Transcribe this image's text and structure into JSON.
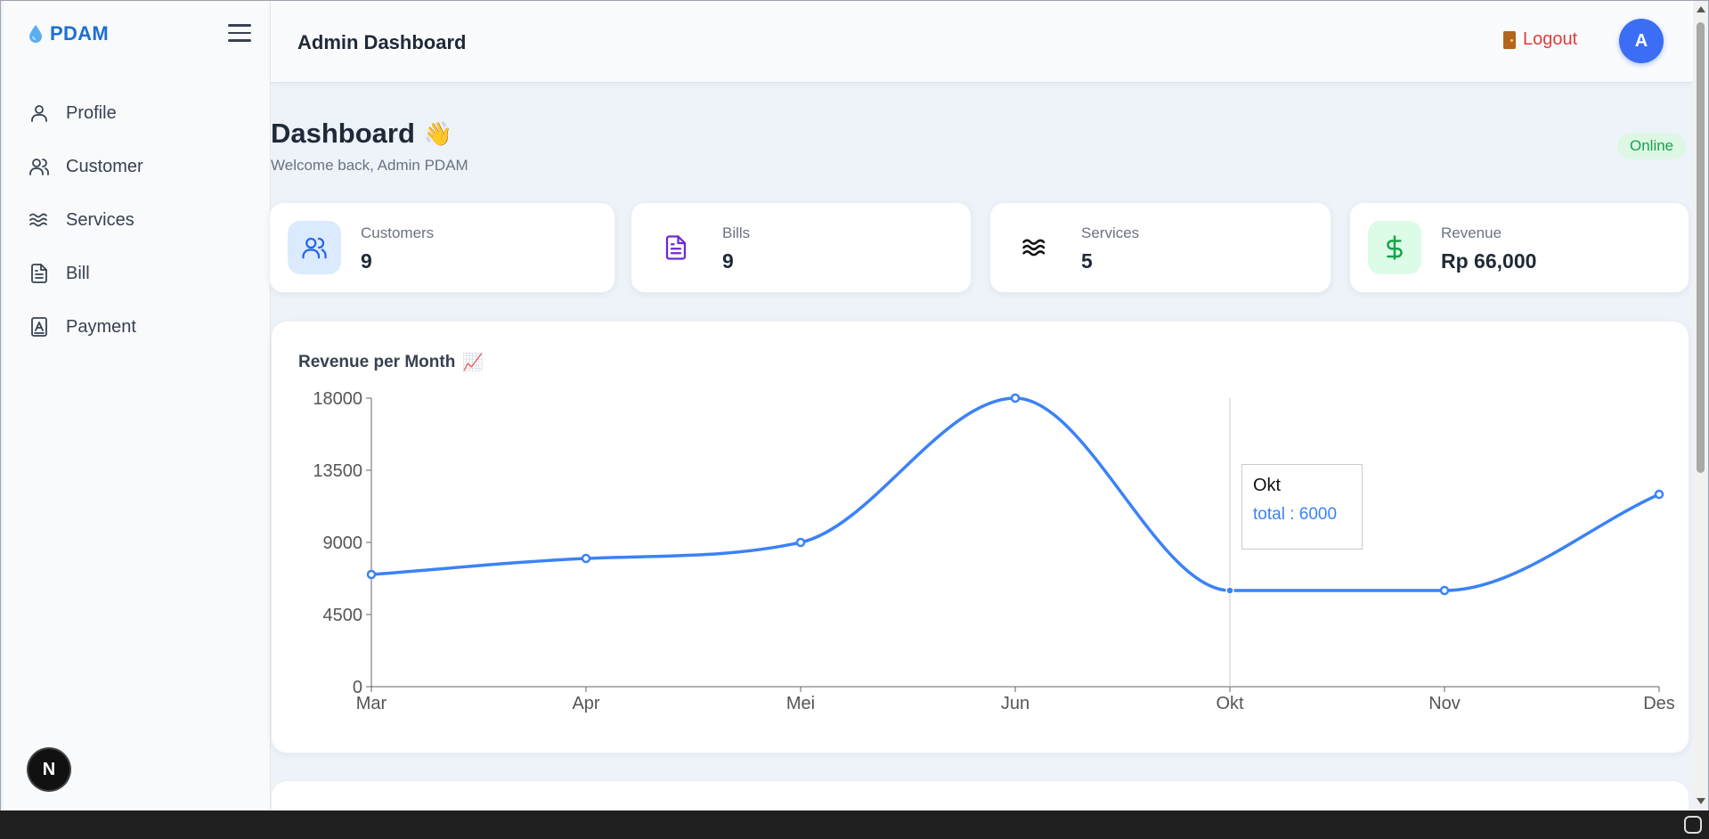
{
  "sidebar": {
    "brand": "PDAM",
    "items": [
      {
        "label": "Profile",
        "icon": "user-icon"
      },
      {
        "label": "Customer",
        "icon": "users-icon"
      },
      {
        "label": "Services",
        "icon": "waves-icon"
      },
      {
        "label": "Bill",
        "icon": "file-text-icon"
      },
      {
        "label": "Payment",
        "icon": "receipt-icon"
      }
    ],
    "dev_badge": "N"
  },
  "topbar": {
    "title": "Admin Dashboard",
    "logout_label": "Logout",
    "avatar_initial": "A"
  },
  "header": {
    "title": "Dashboard",
    "emoji": "👋",
    "welcome": "Welcome back, Admin PDAM",
    "status": "Online"
  },
  "stats": [
    {
      "label": "Customers",
      "value": "9",
      "icon": "users-icon",
      "color": "#2563eb",
      "bg": "#dbeafe"
    },
    {
      "label": "Bills",
      "value": "9",
      "icon": "file-text-icon",
      "color": "#6d28d9",
      "bg": "#ffffff"
    },
    {
      "label": "Services",
      "value": "5",
      "icon": "waves-icon",
      "color": "#111111",
      "bg": "#ffffff"
    },
    {
      "label": "Revenue",
      "value": "Rp 66,000",
      "icon": "dollar-icon",
      "color": "#16a34a",
      "bg": "#dcfce7"
    }
  ],
  "chart": {
    "title": "Revenue per Month",
    "emoji": "📈",
    "tooltip": {
      "label": "Okt",
      "text": "total : 6000"
    }
  },
  "chart_data": {
    "type": "line",
    "title": "Revenue per Month",
    "categories": [
      "Mar",
      "Apr",
      "Mei",
      "Jun",
      "Okt",
      "Nov",
      "Des"
    ],
    "series": [
      {
        "name": "total",
        "values": [
          7000,
          8000,
          9000,
          18000,
          6000,
          6000,
          12000
        ]
      }
    ],
    "yticks": [
      "0",
      "4500",
      "9000",
      "13500",
      "18000"
    ],
    "ylim": [
      0,
      18000
    ],
    "color": "#3b82f6",
    "grid": false,
    "active_index": 4
  }
}
